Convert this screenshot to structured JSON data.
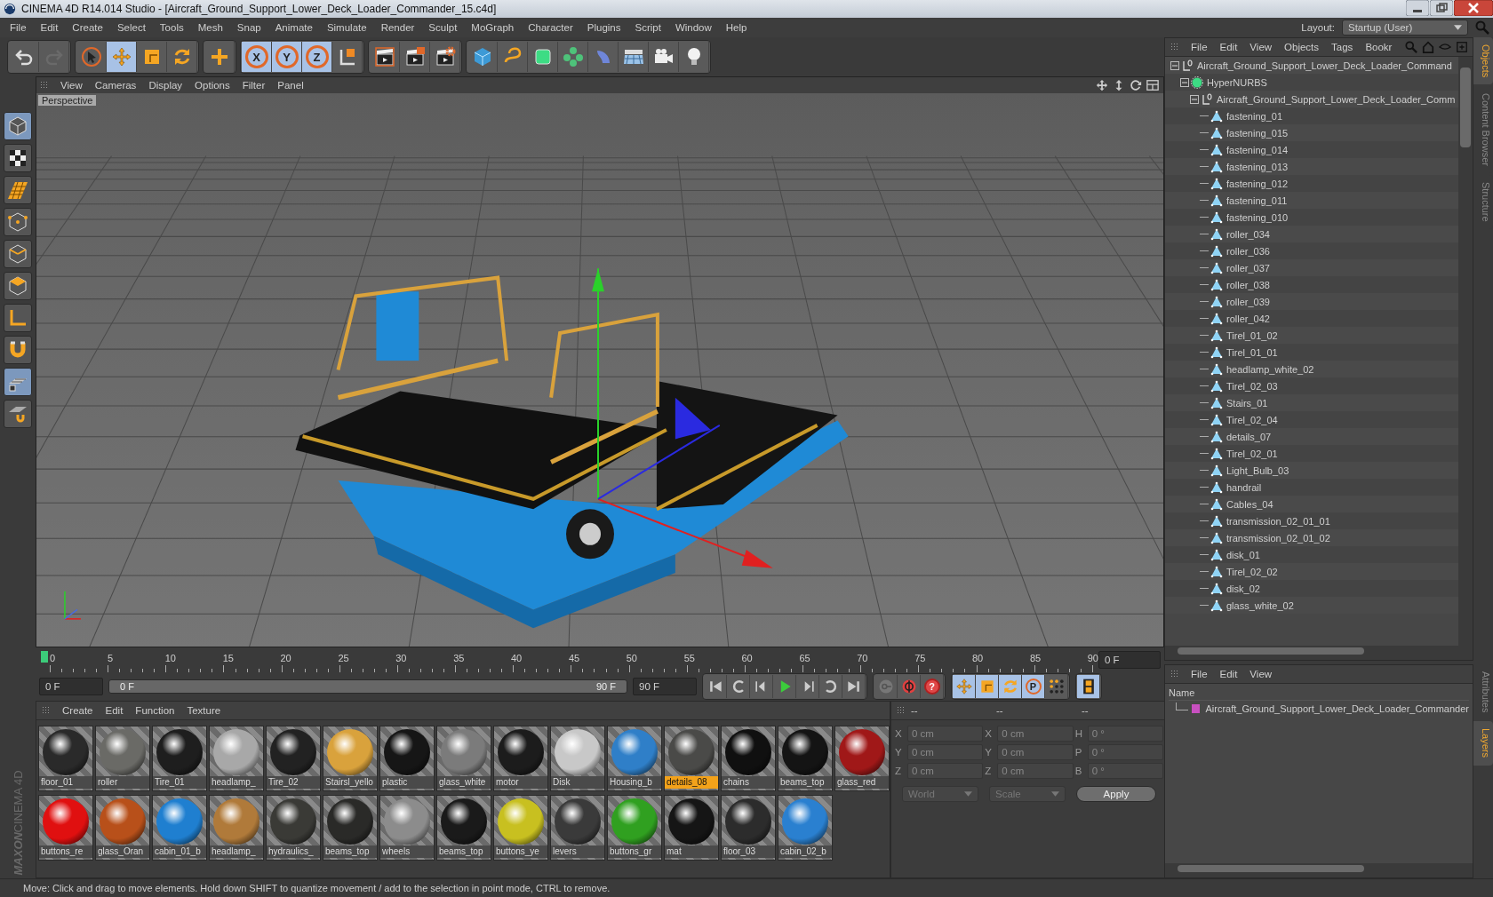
{
  "window": {
    "title": "CINEMA 4D R14.014 Studio - [Aircraft_Ground_Support_Lower_Deck_Loader_Commander_15.c4d]"
  },
  "menu_bar": [
    "File",
    "Edit",
    "Create",
    "Select",
    "Tools",
    "Mesh",
    "Snap",
    "Animate",
    "Simulate",
    "Render",
    "Sculpt",
    "MoGraph",
    "Character",
    "Plugins",
    "Script",
    "Window",
    "Help"
  ],
  "layout": {
    "label": "Layout:",
    "value": "Startup (User)"
  },
  "toolbar": [
    [
      {
        "kind": "undo",
        "active": false
      },
      {
        "kind": "redo",
        "active": false
      }
    ],
    [
      {
        "kind": "select",
        "active": false
      },
      {
        "kind": "move",
        "active": true
      },
      {
        "kind": "scale",
        "active": false
      },
      {
        "kind": "rotate",
        "active": false
      }
    ],
    [
      {
        "kind": "add",
        "active": false
      }
    ],
    [
      {
        "kind": "axis",
        "label": "X",
        "active": true
      },
      {
        "kind": "axis",
        "label": "Y",
        "active": true
      },
      {
        "kind": "axis",
        "label": "Z",
        "active": true
      },
      {
        "kind": "coord",
        "active": false
      }
    ],
    [
      {
        "kind": "render-view",
        "active": false
      },
      {
        "kind": "render",
        "active": false
      },
      {
        "kind": "render-settings",
        "active": false
      }
    ],
    [
      {
        "kind": "cube",
        "active": false
      },
      {
        "kind": "spline",
        "active": false
      },
      {
        "kind": "nurbs",
        "active": false
      },
      {
        "kind": "array",
        "active": false
      },
      {
        "kind": "deformer",
        "active": false
      },
      {
        "kind": "floor",
        "active": false
      },
      {
        "kind": "camera",
        "active": false
      },
      {
        "kind": "light",
        "active": false
      }
    ]
  ],
  "left_tools": [
    {
      "kind": "model",
      "active": true
    },
    {
      "kind": "texture",
      "active": false
    },
    {
      "kind": "workplane",
      "active": false
    },
    {
      "kind": "points",
      "active": false
    },
    {
      "kind": "edges",
      "active": false
    },
    {
      "kind": "polygons",
      "active": false
    },
    {
      "kind": "axis-mode",
      "active": false
    },
    {
      "kind": "magnet",
      "active": false
    },
    {
      "kind": "grid-lock",
      "active": true
    },
    {
      "kind": "snap",
      "active": false
    }
  ],
  "brand": {
    "maker": "MAXON",
    "product": "CINEMA 4D"
  },
  "viewport": {
    "menu": [
      "View",
      "Cameras",
      "Display",
      "Options",
      "Filter",
      "Panel"
    ],
    "camera": "Perspective"
  },
  "timeline": {
    "ruler": [
      "0",
      "5",
      "10",
      "15",
      "20",
      "25",
      "30",
      "35",
      "40",
      "45",
      "50",
      "55",
      "60",
      "65",
      "70",
      "75",
      "80",
      "85",
      "90"
    ],
    "current_frame": "0 F",
    "start": "0 F",
    "range": {
      "start": "0 F",
      "end": "90 F"
    },
    "end": "90 F",
    "playback": [
      {
        "kind": "to-start",
        "active": false
      },
      {
        "kind": "loop-back",
        "active": false
      },
      {
        "kind": "step-back",
        "active": false
      },
      {
        "kind": "play",
        "active": false
      },
      {
        "kind": "step-forward",
        "active": false
      },
      {
        "kind": "loop-forward",
        "active": false
      },
      {
        "kind": "to-end",
        "active": false
      }
    ],
    "keys": [
      {
        "kind": "key",
        "active": false
      },
      {
        "kind": "autokey",
        "active": false
      },
      {
        "kind": "help",
        "label": "?",
        "active": false
      }
    ],
    "modes": [
      {
        "kind": "move",
        "active": true
      },
      {
        "kind": "scale",
        "active": true
      },
      {
        "kind": "rotate",
        "active": true
      },
      {
        "kind": "param",
        "label": "P",
        "active": true
      },
      {
        "kind": "points-grid",
        "active": false
      }
    ],
    "film": [
      {
        "kind": "film",
        "active": true
      }
    ]
  },
  "materials": {
    "menu": [
      "Create",
      "Edit",
      "Function",
      "Texture"
    ],
    "items": [
      {
        "name": "floor_01",
        "color": "#2a2a2a",
        "selected": false
      },
      {
        "name": "roller",
        "color": "#6a6a66",
        "selected": false
      },
      {
        "name": "Tire_01",
        "color": "#1e1e1e",
        "selected": false
      },
      {
        "name": "headlamp_",
        "color": "#a8a8a8",
        "selected": false
      },
      {
        "name": "Tire_02",
        "color": "#222222",
        "selected": false
      },
      {
        "name": "Stairsl_yello",
        "color": "#d9a23c",
        "selected": false
      },
      {
        "name": "plastic",
        "color": "#161616",
        "selected": false
      },
      {
        "name": "glass_white",
        "color": "#7b7b7b",
        "selected": false
      },
      {
        "name": "motor",
        "color": "#1c1c1c",
        "selected": false
      },
      {
        "name": "Disk",
        "color": "#c8c8c8",
        "selected": false
      },
      {
        "name": "Housing_b",
        "color": "#2f7fc8",
        "selected": false
      },
      {
        "name": "details_08",
        "color": "#4a4a48",
        "selected": true
      },
      {
        "name": "chains",
        "color": "#101010",
        "selected": false
      },
      {
        "name": "beams_top",
        "color": "#141414",
        "selected": false
      },
      {
        "name": "glass_red",
        "color": "#a01818",
        "selected": false
      },
      {
        "name": "buttons_re",
        "color": "#e01010",
        "selected": false
      },
      {
        "name": "glass_Oran",
        "color": "#b8501a",
        "selected": false
      },
      {
        "name": "cabin_01_b",
        "color": "#1f7fd0",
        "selected": false
      },
      {
        "name": "headlamp_",
        "color": "#b07a3a",
        "selected": false
      },
      {
        "name": "hydraulics_",
        "color": "#3a3a36",
        "selected": false
      },
      {
        "name": "beams_top",
        "color": "#2a2a28",
        "selected": false
      },
      {
        "name": "wheels",
        "color": "#8c8c8c",
        "selected": false
      },
      {
        "name": "beams_top",
        "color": "#1a1a1a",
        "selected": false
      },
      {
        "name": "buttons_ye",
        "color": "#c8c020",
        "selected": false
      },
      {
        "name": "levers",
        "color": "#3a3a3a",
        "selected": false
      },
      {
        "name": "buttons_gr",
        "color": "#30a020",
        "selected": false
      },
      {
        "name": "mat",
        "color": "#151515",
        "selected": false
      },
      {
        "name": "floor_03",
        "color": "#2c2c2c",
        "selected": false
      },
      {
        "name": "cabin_02_b",
        "color": "#2a80d0",
        "selected": false
      }
    ]
  },
  "coordinates": {
    "headers": [
      "--",
      "--",
      "--"
    ],
    "rows": [
      [
        {
          "label": "X",
          "value": "0 cm"
        },
        {
          "label": "X",
          "value": "0 cm"
        },
        {
          "label": "H",
          "value": "0 °"
        }
      ],
      [
        {
          "label": "Y",
          "value": "0 cm"
        },
        {
          "label": "Y",
          "value": "0 cm"
        },
        {
          "label": "P",
          "value": "0 °"
        }
      ],
      [
        {
          "label": "Z",
          "value": "0 cm"
        },
        {
          "label": "Z",
          "value": "0 cm"
        },
        {
          "label": "B",
          "value": "0 °"
        }
      ]
    ],
    "dropdowns": [
      "World",
      "Scale"
    ],
    "apply": "Apply"
  },
  "object_manager": {
    "menu": [
      "File",
      "Edit",
      "View",
      "Objects",
      "Tags",
      "Bookr"
    ],
    "side_tabs": [
      {
        "label": "Objects",
        "selected": true
      },
      {
        "label": "Content Browser",
        "selected": false
      },
      {
        "label": "Structure",
        "selected": false
      }
    ],
    "tree": [
      {
        "name": "Aircraft_Ground_Support_Lower_Deck_Loader_Command",
        "kind": "null",
        "expanded": true,
        "children": [
          {
            "name": "HyperNURBS",
            "kind": "nurbs",
            "expanded": true,
            "children": [
              {
                "name": "Aircraft_Ground_Support_Lower_Deck_Loader_Comm",
                "kind": "null",
                "expanded": true,
                "children": [
                  {
                    "name": "fastening_01",
                    "kind": "polygon"
                  },
                  {
                    "name": "fastening_015",
                    "kind": "polygon"
                  },
                  {
                    "name": "fastening_014",
                    "kind": "polygon"
                  },
                  {
                    "name": "fastening_013",
                    "kind": "polygon"
                  },
                  {
                    "name": "fastening_012",
                    "kind": "polygon"
                  },
                  {
                    "name": "fastening_011",
                    "kind": "polygon"
                  },
                  {
                    "name": "fastening_010",
                    "kind": "polygon"
                  },
                  {
                    "name": "roller_034",
                    "kind": "polygon"
                  },
                  {
                    "name": "roller_036",
                    "kind": "polygon"
                  },
                  {
                    "name": "roller_037",
                    "kind": "polygon"
                  },
                  {
                    "name": "roller_038",
                    "kind": "polygon"
                  },
                  {
                    "name": "roller_039",
                    "kind": "polygon"
                  },
                  {
                    "name": "roller_042",
                    "kind": "polygon"
                  },
                  {
                    "name": "Tirel_01_02",
                    "kind": "polygon"
                  },
                  {
                    "name": "Tirel_01_01",
                    "kind": "polygon"
                  },
                  {
                    "name": "headlamp_white_02",
                    "kind": "polygon"
                  },
                  {
                    "name": "Tirel_02_03",
                    "kind": "polygon"
                  },
                  {
                    "name": "Stairs_01",
                    "kind": "polygon"
                  },
                  {
                    "name": "Tirel_02_04",
                    "kind": "polygon"
                  },
                  {
                    "name": "details_07",
                    "kind": "polygon"
                  },
                  {
                    "name": "Tirel_02_01",
                    "kind": "polygon"
                  },
                  {
                    "name": "Light_Bulb_03",
                    "kind": "polygon"
                  },
                  {
                    "name": "handrail",
                    "kind": "polygon"
                  },
                  {
                    "name": "Cables_04",
                    "kind": "polygon"
                  },
                  {
                    "name": "transmission_02_01_01",
                    "kind": "polygon"
                  },
                  {
                    "name": "transmission_02_01_02",
                    "kind": "polygon"
                  },
                  {
                    "name": "disk_01",
                    "kind": "polygon"
                  },
                  {
                    "name": "Tirel_02_02",
                    "kind": "polygon"
                  },
                  {
                    "name": "disk_02",
                    "kind": "polygon"
                  },
                  {
                    "name": "glass_white_02",
                    "kind": "polygon"
                  }
                ]
              }
            ]
          }
        ]
      }
    ]
  },
  "layers": {
    "menu": [
      "File",
      "Edit",
      "View"
    ],
    "column": "Name",
    "side_tabs": [
      {
        "label": "Attributes",
        "selected": false
      },
      {
        "label": "Layers",
        "selected": true
      }
    ],
    "rows": [
      {
        "name": "Aircraft_Ground_Support_Lower_Deck_Loader_Commander",
        "color": "#c850c0"
      }
    ]
  },
  "status_bar": "Move: Click and drag to move elements. Hold down SHIFT to quantize movement / add to the selection in point mode, CTRL to remove."
}
